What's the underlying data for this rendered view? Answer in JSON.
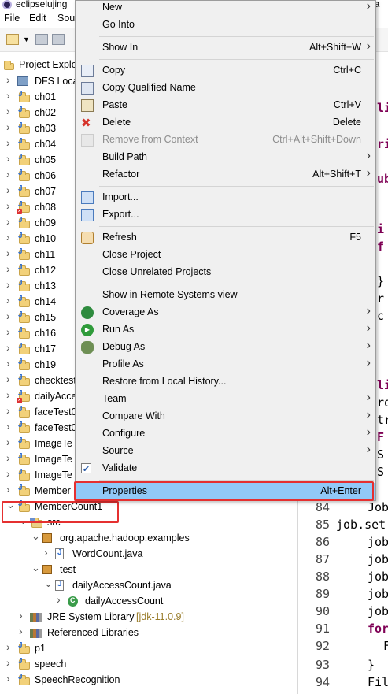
{
  "window": {
    "title": "eclipselujing",
    "title_right": "ava"
  },
  "menubar": {
    "items": [
      "File",
      "Edit",
      "Sou"
    ]
  },
  "explorer": {
    "header": "Project Explo",
    "rows": [
      {
        "label": "DFS Loca",
        "icon": "dfs-icon",
        "expanded": false,
        "indent": 0
      },
      {
        "label": "ch01",
        "icon": "java-project-icon",
        "expanded": false,
        "indent": 0
      },
      {
        "label": "ch02",
        "icon": "java-project-icon",
        "expanded": false,
        "indent": 0
      },
      {
        "label": "ch03",
        "icon": "java-project-icon",
        "expanded": false,
        "indent": 0
      },
      {
        "label": "ch04",
        "icon": "java-project-icon",
        "expanded": false,
        "indent": 0
      },
      {
        "label": "ch05",
        "icon": "java-project-icon",
        "expanded": false,
        "indent": 0
      },
      {
        "label": "ch06",
        "icon": "java-project-icon",
        "expanded": false,
        "indent": 0
      },
      {
        "label": "ch07",
        "icon": "java-project-icon",
        "expanded": false,
        "indent": 0
      },
      {
        "label": "ch08",
        "icon": "java-project-error-icon",
        "expanded": false,
        "indent": 0
      },
      {
        "label": "ch09",
        "icon": "java-project-icon",
        "expanded": false,
        "indent": 0
      },
      {
        "label": "ch10",
        "icon": "java-project-icon",
        "expanded": false,
        "indent": 0
      },
      {
        "label": "ch11",
        "icon": "java-project-icon",
        "expanded": false,
        "indent": 0
      },
      {
        "label": "ch12",
        "icon": "java-project-icon",
        "expanded": false,
        "indent": 0
      },
      {
        "label": "ch13",
        "icon": "java-project-icon",
        "expanded": false,
        "indent": 0
      },
      {
        "label": "ch14",
        "icon": "java-project-icon",
        "expanded": false,
        "indent": 0
      },
      {
        "label": "ch15",
        "icon": "java-project-icon",
        "expanded": false,
        "indent": 0
      },
      {
        "label": "ch16",
        "icon": "java-project-icon",
        "expanded": false,
        "indent": 0
      },
      {
        "label": "ch17",
        "icon": "java-project-icon",
        "expanded": false,
        "indent": 0
      },
      {
        "label": "ch19",
        "icon": "java-project-icon",
        "expanded": false,
        "indent": 0
      },
      {
        "label": "checktest",
        "icon": "java-project-icon",
        "expanded": false,
        "indent": 0
      },
      {
        "label": "dailyAcce",
        "icon": "java-project-error-icon",
        "expanded": false,
        "indent": 0
      },
      {
        "label": "faceTest0",
        "icon": "java-project-icon",
        "expanded": false,
        "indent": 0
      },
      {
        "label": "faceTest0",
        "icon": "java-project-icon",
        "expanded": false,
        "indent": 0
      },
      {
        "label": "ImageTe",
        "icon": "java-project-icon",
        "expanded": false,
        "indent": 0
      },
      {
        "label": "ImageTe",
        "icon": "java-project-icon",
        "expanded": false,
        "indent": 0
      },
      {
        "label": "ImageTe",
        "icon": "java-project-icon",
        "expanded": false,
        "indent": 0
      },
      {
        "label": "Member",
        "icon": "java-project-icon",
        "expanded": false,
        "indent": 0
      },
      {
        "label": "MemberCount1",
        "icon": "java-project-icon",
        "expanded": true,
        "indent": 0
      },
      {
        "label": "src",
        "icon": "source-folder-icon",
        "expanded": true,
        "indent": 1
      },
      {
        "label": "org.apache.hadoop.examples",
        "icon": "package-icon",
        "expanded": true,
        "indent": 2
      },
      {
        "label": "WordCount.java",
        "icon": "java-file-icon",
        "expanded": false,
        "indent": 3
      },
      {
        "label": "test",
        "icon": "package-icon",
        "expanded": true,
        "indent": 2
      },
      {
        "label": "dailyAccessCount.java",
        "icon": "java-file-icon",
        "expanded": true,
        "indent": 3
      },
      {
        "label": "dailyAccessCount",
        "icon": "java-class-icon",
        "expanded": false,
        "indent": 4
      },
      {
        "label": "JRE System Library",
        "label_extra": "[jdk-11.0.9]",
        "icon": "library-icon",
        "expanded": false,
        "indent": 1
      },
      {
        "label": "Referenced Libraries",
        "icon": "library-icon",
        "expanded": false,
        "indent": 1
      },
      {
        "label": "p1",
        "icon": "java-project-icon",
        "expanded": false,
        "indent": 0
      },
      {
        "label": "speech",
        "icon": "java-project-icon",
        "expanded": false,
        "indent": 0
      },
      {
        "label": "SpeechRecognition",
        "icon": "java-project-icon",
        "expanded": false,
        "indent": 0
      }
    ]
  },
  "editor": {
    "lines": [
      {
        "num": "",
        "text": "li",
        "kw": true
      },
      {
        "num": "",
        "text": "ri",
        "kw": true
      },
      {
        "num": "",
        "text": "ub",
        "kw": true
      },
      {
        "num": "",
        "text": "i",
        "kw": true
      },
      {
        "num": "",
        "text": "f",
        "kw": true
      },
      {
        "num": "",
        "text": "}",
        "kw": false
      },
      {
        "num": "",
        "text": "r",
        "kw": false
      },
      {
        "num": "",
        "text": "c",
        "kw": false
      },
      {
        "num": "",
        "text": "li",
        "kw": true
      },
      {
        "num": "",
        "text": "ro",
        "kw": false
      },
      {
        "num": "",
        "text": "tr",
        "kw": false
      },
      {
        "num": "",
        "text": "F",
        "kw": true
      },
      {
        "num": "",
        "text": "S",
        "kw": false
      },
      {
        "num": "",
        "text": "S",
        "kw": false
      },
      {
        "num": "84",
        "text": "Job",
        "kw": false
      },
      {
        "num": "85",
        "text": "job.set",
        "kw": false
      },
      {
        "num": "86",
        "text": "job",
        "kw": false
      },
      {
        "num": "87",
        "text": "job",
        "kw": false
      },
      {
        "num": "88",
        "text": "job",
        "kw": false
      },
      {
        "num": "89",
        "text": "job",
        "kw": false
      },
      {
        "num": "90",
        "text": "job",
        "kw": false
      },
      {
        "num": "91",
        "text": "for",
        "kw": true
      },
      {
        "num": "92",
        "text": "F",
        "kw": false
      },
      {
        "num": "93",
        "text": "}",
        "kw": false
      },
      {
        "num": "94",
        "text": "Fil",
        "kw": false
      }
    ]
  },
  "context_menu": {
    "items": [
      {
        "label": "New",
        "shortcut": "",
        "submenu": true,
        "icon": ""
      },
      {
        "label": "Go Into",
        "shortcut": "",
        "submenu": false,
        "icon": ""
      },
      {
        "sep": true
      },
      {
        "label": "Show In",
        "shortcut": "Alt+Shift+W",
        "submenu": true,
        "icon": ""
      },
      {
        "sep": true
      },
      {
        "label": "Copy",
        "shortcut": "Ctrl+C",
        "submenu": false,
        "icon": "copy-icon"
      },
      {
        "label": "Copy Qualified Name",
        "shortcut": "",
        "submenu": false,
        "icon": "copy-qualified-icon"
      },
      {
        "label": "Paste",
        "shortcut": "Ctrl+V",
        "submenu": false,
        "icon": "paste-icon"
      },
      {
        "label": "Delete",
        "shortcut": "Delete",
        "submenu": false,
        "icon": "delete-icon"
      },
      {
        "label": "Remove from Context",
        "shortcut": "Ctrl+Alt+Shift+Down",
        "submenu": false,
        "icon": "remove-context-icon",
        "disabled": true
      },
      {
        "label": "Build Path",
        "shortcut": "",
        "submenu": true,
        "icon": ""
      },
      {
        "label": "Refactor",
        "shortcut": "Alt+Shift+T",
        "submenu": true,
        "icon": ""
      },
      {
        "sep": true
      },
      {
        "label": "Import...",
        "shortcut": "",
        "submenu": false,
        "icon": "import-icon"
      },
      {
        "label": "Export...",
        "shortcut": "",
        "submenu": false,
        "icon": "export-icon"
      },
      {
        "sep": true
      },
      {
        "label": "Refresh",
        "shortcut": "F5",
        "submenu": false,
        "icon": "refresh-icon"
      },
      {
        "label": "Close Project",
        "shortcut": "",
        "submenu": false,
        "icon": ""
      },
      {
        "label": "Close Unrelated Projects",
        "shortcut": "",
        "submenu": false,
        "icon": ""
      },
      {
        "sep": true
      },
      {
        "label": "Show in Remote Systems view",
        "shortcut": "",
        "submenu": false,
        "icon": ""
      },
      {
        "label": "Coverage As",
        "shortcut": "",
        "submenu": true,
        "icon": "coverage-icon"
      },
      {
        "label": "Run As",
        "shortcut": "",
        "submenu": true,
        "icon": "run-icon"
      },
      {
        "label": "Debug As",
        "shortcut": "",
        "submenu": true,
        "icon": "debug-icon"
      },
      {
        "label": "Profile As",
        "shortcut": "",
        "submenu": true,
        "icon": ""
      },
      {
        "label": "Restore from Local History...",
        "shortcut": "",
        "submenu": false,
        "icon": ""
      },
      {
        "label": "Team",
        "shortcut": "",
        "submenu": true,
        "icon": ""
      },
      {
        "label": "Compare With",
        "shortcut": "",
        "submenu": true,
        "icon": ""
      },
      {
        "label": "Configure",
        "shortcut": "",
        "submenu": true,
        "icon": ""
      },
      {
        "label": "Source",
        "shortcut": "",
        "submenu": true,
        "icon": ""
      },
      {
        "label": "Validate",
        "shortcut": "",
        "submenu": false,
        "icon": "checkbox-checked-icon"
      },
      {
        "sep": true
      },
      {
        "label": "Properties",
        "shortcut": "Alt+Enter",
        "submenu": false,
        "icon": "",
        "selected": true
      }
    ]
  },
  "colors": {
    "selection": "#91c9f7",
    "highlight_box": "#e53030",
    "menu_bg": "#f0f0f0",
    "keyword": "#7f0055"
  }
}
